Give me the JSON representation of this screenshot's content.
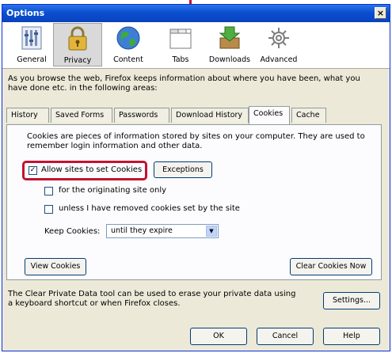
{
  "window": {
    "title": "Options",
    "close_label": "×"
  },
  "toolbar": {
    "items": [
      {
        "label": "General",
        "icon": "general-icon"
      },
      {
        "label": "Privacy",
        "icon": "lock-icon",
        "selected": true
      },
      {
        "label": "Content",
        "icon": "globe-icon"
      },
      {
        "label": "Tabs",
        "icon": "tabs-icon"
      },
      {
        "label": "Downloads",
        "icon": "download-icon"
      },
      {
        "label": "Advanced",
        "icon": "gear-icon"
      }
    ]
  },
  "privacy": {
    "description": "As you browse the web, Firefox keeps information about where you have been, what you have done etc. in the following areas:",
    "tabs": [
      {
        "label": "History"
      },
      {
        "label": "Saved Forms"
      },
      {
        "label": "Passwords"
      },
      {
        "label": "Download History"
      },
      {
        "label": "Cookies",
        "active": true
      },
      {
        "label": "Cache"
      }
    ],
    "cookies": {
      "info": "Cookies are pieces of information stored by sites on your computer. They are used to remember login information and other data.",
      "allow_label": "Allow sites to set Cookies",
      "allow_checked": "✓",
      "exceptions_label": "Exceptions",
      "originating_label": "for the originating site only",
      "unless_label": "unless I have removed cookies set by the site",
      "keep_label": "Keep Cookies:",
      "keep_value": "until they expire",
      "view_label": "View Cookies",
      "clear_label": "Clear Cookies Now"
    },
    "clear_private": {
      "text": "The Clear Private Data tool can be used to erase your private data using a keyboard shortcut or when Firefox closes.",
      "settings_label": "Settings..."
    }
  },
  "footer": {
    "ok_label": "OK",
    "cancel_label": "Cancel",
    "help_label": "Help"
  },
  "colors": {
    "accent": "#c4122f",
    "titlebar": "#0a4fd0"
  }
}
